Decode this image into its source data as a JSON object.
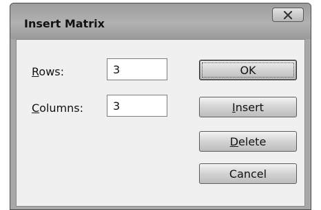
{
  "dialog": {
    "title": "Insert Matrix",
    "close_icon": "close-x-icon"
  },
  "fields": {
    "rows": {
      "label_mnemonic": "R",
      "label_rest": "ows:",
      "value": "3"
    },
    "columns": {
      "label_mnemonic": "C",
      "label_rest": "olumns:",
      "value": "3"
    }
  },
  "buttons": {
    "ok": {
      "label": "OK"
    },
    "insert": {
      "mnemonic": "I",
      "rest": "nsert"
    },
    "delete": {
      "mnemonic": "D",
      "rest": "elete"
    },
    "cancel": {
      "label": "Cancel"
    }
  }
}
